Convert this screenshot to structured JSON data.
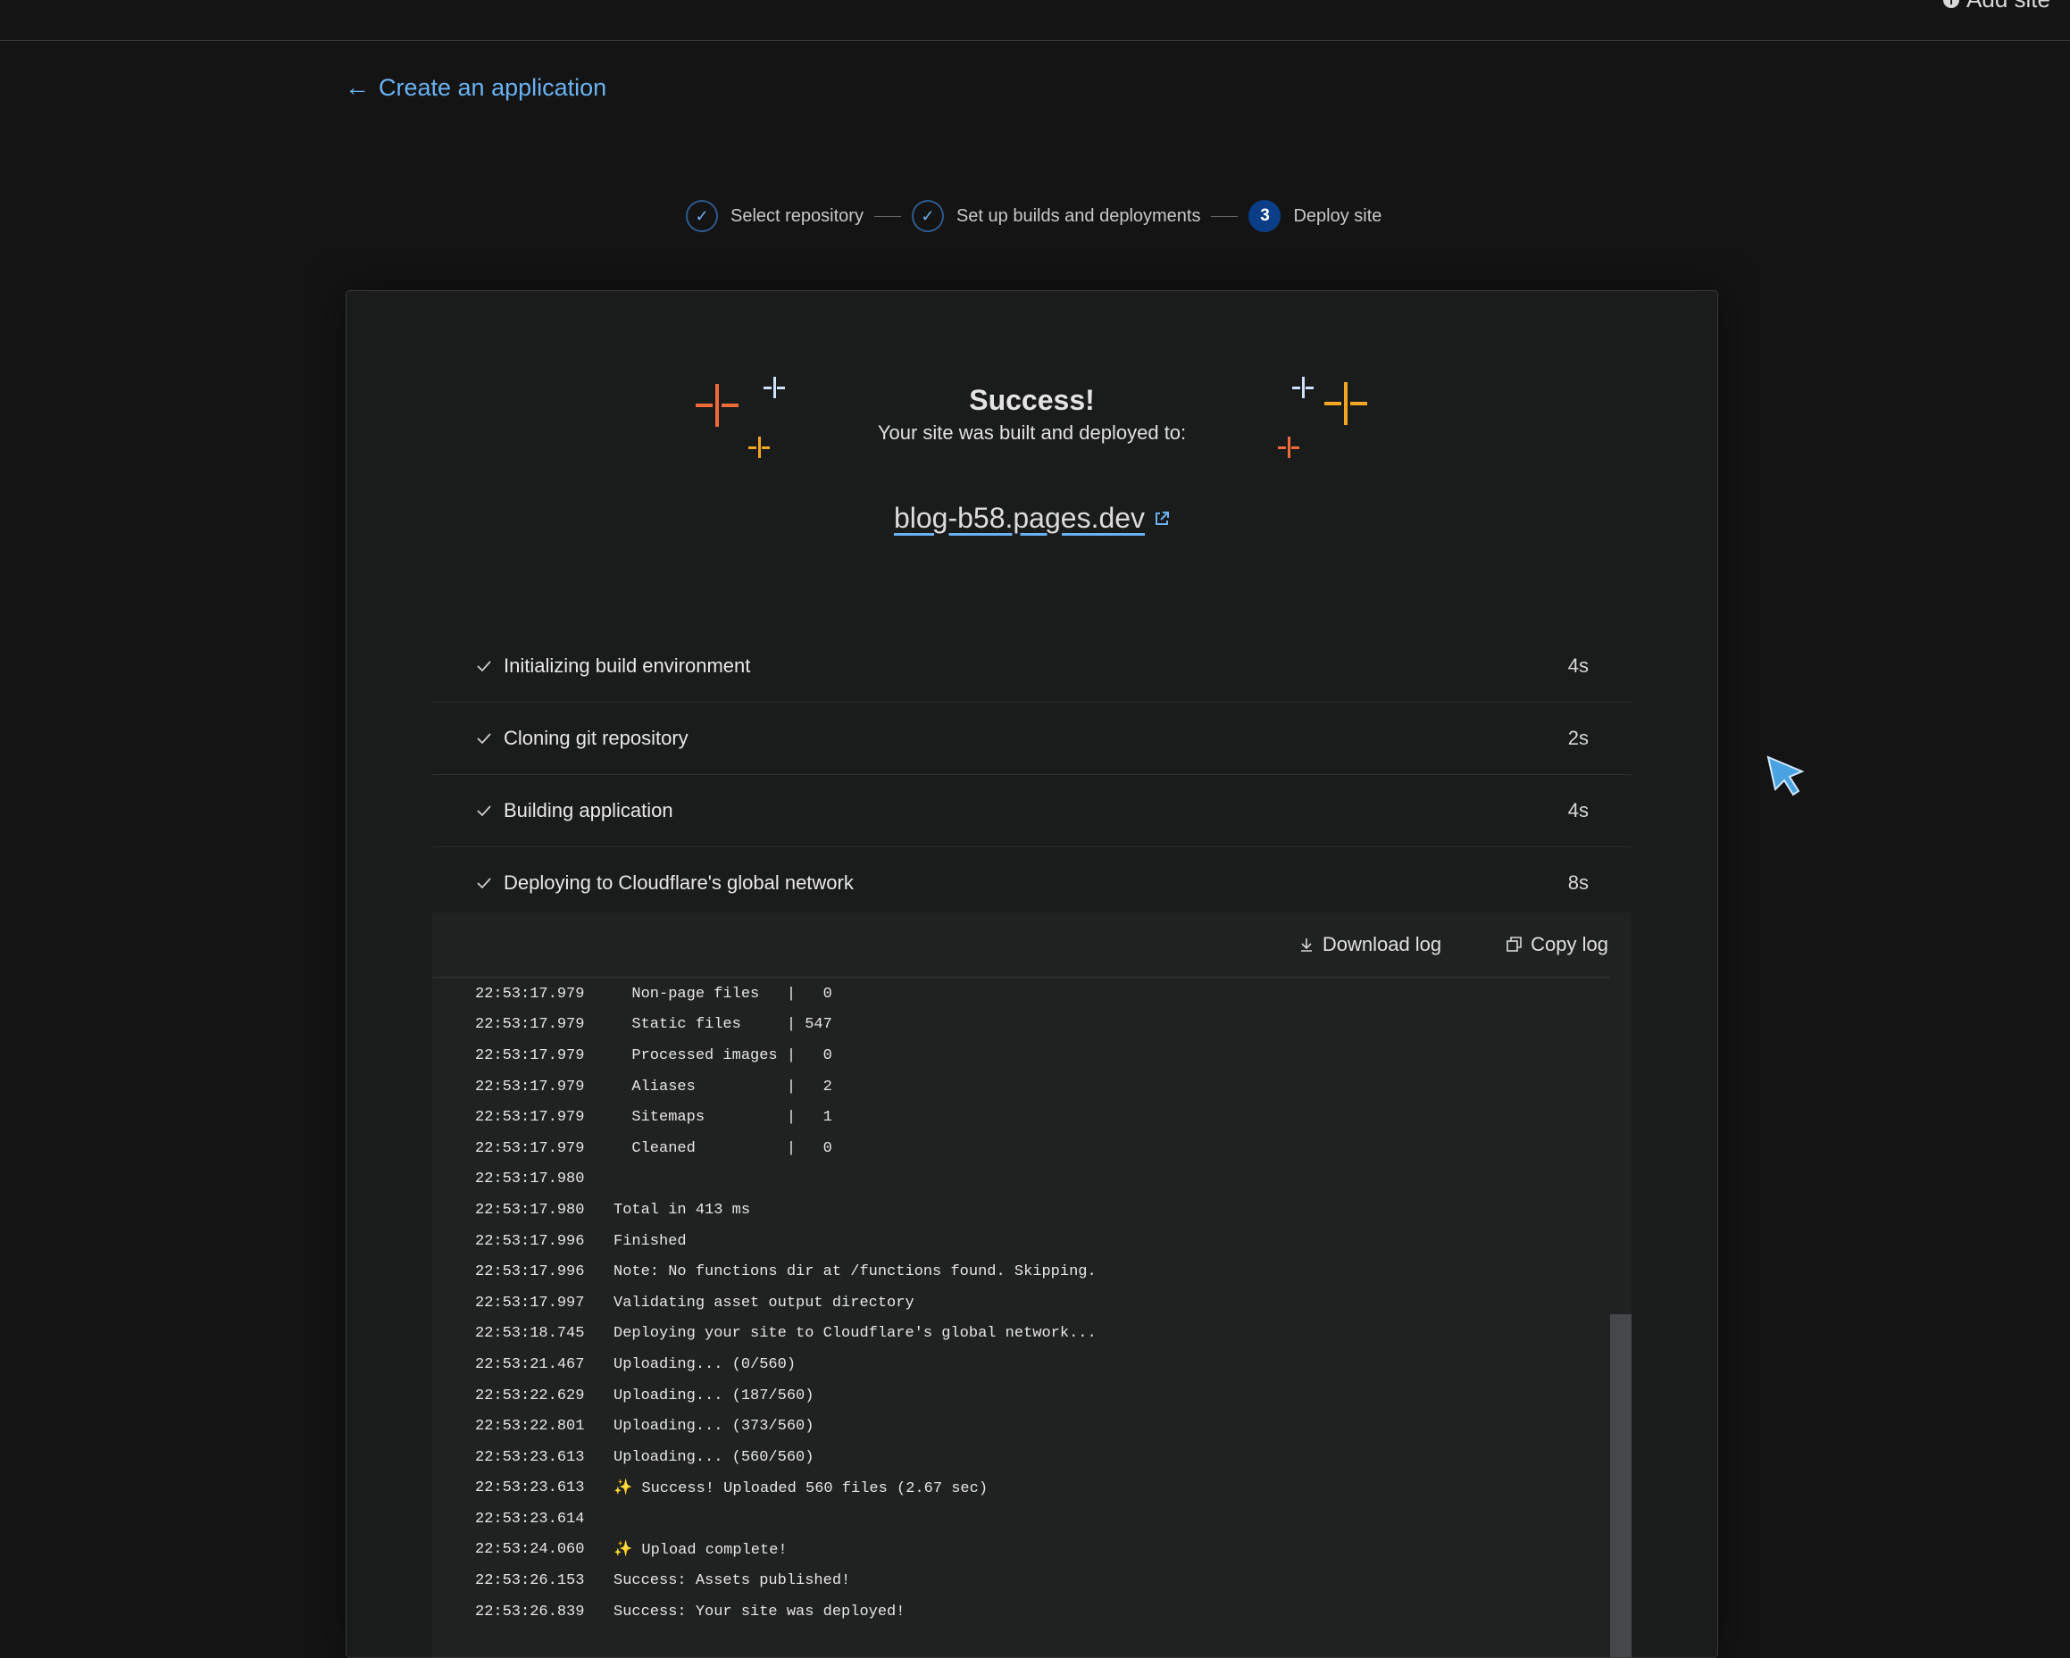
{
  "topbar": {
    "add_site_label": "Add site"
  },
  "nav": {
    "back_label": "Create an application"
  },
  "stepper": {
    "steps": [
      {
        "label": "Select repository",
        "state": "done"
      },
      {
        "label": "Set up builds and deployments",
        "state": "done"
      },
      {
        "number": "3",
        "label": "Deploy site",
        "state": "active"
      }
    ]
  },
  "result": {
    "title": "Success!",
    "subtitle": "Your site was built and deployed to:",
    "site_url": "blog-b58.pages.dev"
  },
  "build_steps": [
    {
      "name": "Initializing build environment",
      "duration": "4s"
    },
    {
      "name": "Cloning git repository",
      "duration": "2s"
    },
    {
      "name": "Building application",
      "duration": "4s"
    },
    {
      "name": "Deploying to Cloudflare's global network",
      "duration": "8s"
    }
  ],
  "log": {
    "download_label": "Download log",
    "copy_label": "Copy log",
    "lines": [
      {
        "ts": "22:53:17.979",
        "msg": "  Non-page files   |   0"
      },
      {
        "ts": "22:53:17.979",
        "msg": "  Static files     | 547"
      },
      {
        "ts": "22:53:17.979",
        "msg": "  Processed images |   0"
      },
      {
        "ts": "22:53:17.979",
        "msg": "  Aliases          |   2"
      },
      {
        "ts": "22:53:17.979",
        "msg": "  Sitemaps         |   1"
      },
      {
        "ts": "22:53:17.979",
        "msg": "  Cleaned          |   0"
      },
      {
        "ts": "22:53:17.980",
        "msg": ""
      },
      {
        "ts": "22:53:17.980",
        "msg": "Total in 413 ms"
      },
      {
        "ts": "22:53:17.996",
        "msg": "Finished"
      },
      {
        "ts": "22:53:17.996",
        "msg": "Note: No functions dir at /functions found. Skipping."
      },
      {
        "ts": "22:53:17.997",
        "msg": "Validating asset output directory"
      },
      {
        "ts": "22:53:18.745",
        "msg": "Deploying your site to Cloudflare's global network..."
      },
      {
        "ts": "22:53:21.467",
        "msg": "Uploading... (0/560)"
      },
      {
        "ts": "22:53:22.629",
        "msg": "Uploading... (187/560)"
      },
      {
        "ts": "22:53:22.801",
        "msg": "Uploading... (373/560)"
      },
      {
        "ts": "22:53:23.613",
        "msg": "Uploading... (560/560)"
      },
      {
        "ts": "22:53:23.613",
        "msg": "✨ Success! Uploaded 560 files (2.67 sec)"
      },
      {
        "ts": "22:53:23.614",
        "msg": ""
      },
      {
        "ts": "22:53:24.060",
        "msg": "✨ Upload complete!"
      },
      {
        "ts": "22:53:26.153",
        "msg": "Success: Assets published!"
      },
      {
        "ts": "22:53:26.839",
        "msg": "Success: Your site was deployed!"
      }
    ]
  },
  "colors": {
    "accent_link": "#6ab2f2",
    "active_step": "#0b3e87",
    "sparkle_orange": "#f06a3a",
    "sparkle_yellow": "#f5a623",
    "sparkle_blue": "#cfe3ff"
  },
  "icons": [
    "info-icon",
    "arrow-left-icon",
    "check-icon",
    "external-link-icon",
    "download-icon",
    "copy-icon",
    "sparkle-icon",
    "cursor-icon"
  ]
}
